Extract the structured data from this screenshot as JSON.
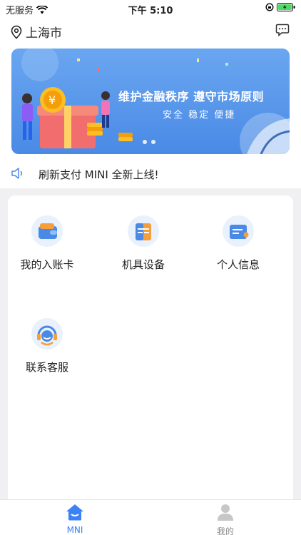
{
  "status": {
    "carrier": "无服务",
    "time": "下午 5:10"
  },
  "header": {
    "city": "上海市"
  },
  "banner": {
    "title": "维护金融秩序  遵守市场原则",
    "subtitle": "安全  稳定  便捷",
    "currency": "¥"
  },
  "notice": {
    "text": "刷新支付 MINI 全新上线!"
  },
  "menu": {
    "items": [
      {
        "label": "我的入账卡",
        "icon": "wallet-icon"
      },
      {
        "label": "机具设备",
        "icon": "device-icon"
      },
      {
        "label": "个人信息",
        "icon": "id-card-icon"
      },
      {
        "label": "联系客服",
        "icon": "customer-service-icon"
      }
    ]
  },
  "tabs": [
    {
      "label": "MNI",
      "icon": "home-icon",
      "active": true
    },
    {
      "label": "我的",
      "icon": "person-icon",
      "active": false
    }
  ],
  "colors": {
    "accent": "#3b82f6",
    "iconBlue": "#4a8ae6",
    "iconOrange": "#f59e3a",
    "inactive": "#b5b5b5"
  }
}
